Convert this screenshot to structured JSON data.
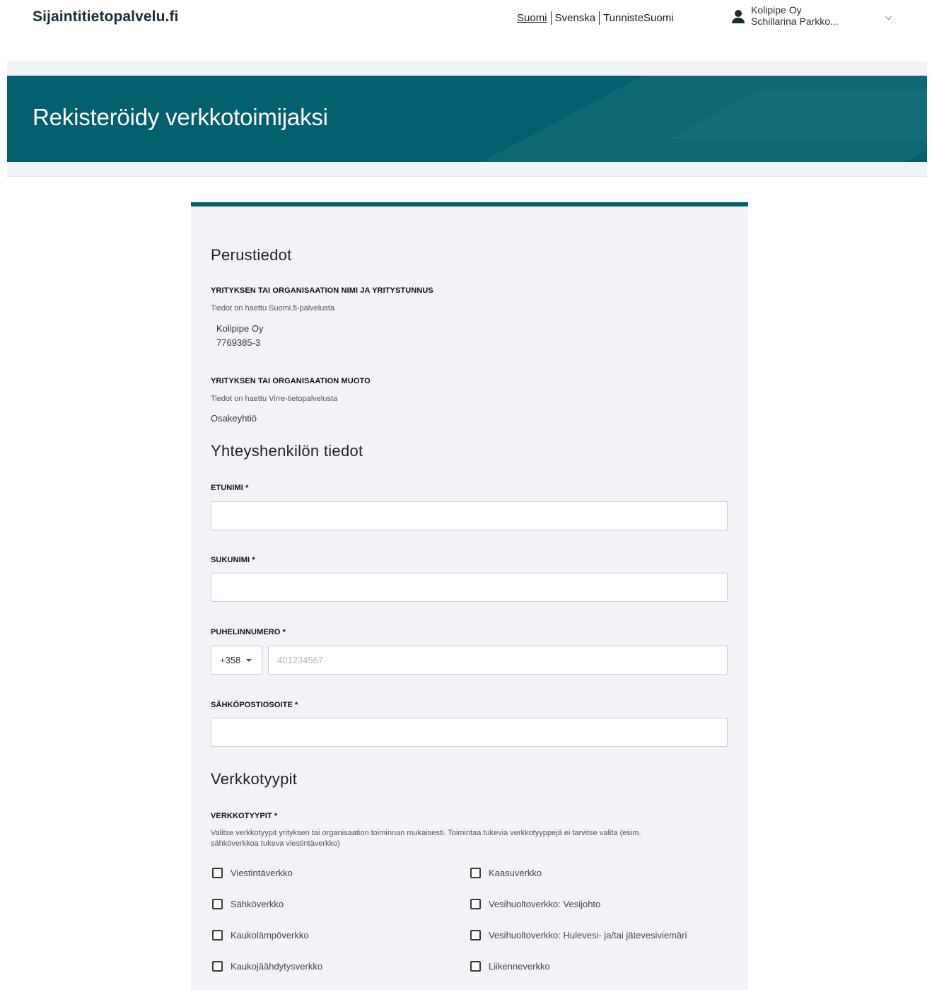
{
  "header": {
    "logo": "Sijaintitietopalvelu.fi",
    "languages": [
      "Suomi",
      "Svenska",
      "TunnisteSuomi"
    ],
    "active_language": "Suomi",
    "user": {
      "org": "Kolipipe Oy",
      "name": "Schillarina Parkko..."
    }
  },
  "page": {
    "title": "Rekisteröidy verkkotoimijaksi"
  },
  "colors": {
    "brand": "#025f6e",
    "card_bg": "#f2f3f6"
  },
  "basic": {
    "title": "Perustiedot",
    "org_label": "YRITYKSEN TAI ORGANISAATION NIMI JA YRITYSTUNNUS",
    "org_hint": "Tiedot on haettu Suomi.fi-palvelusta",
    "org_name": "Kolipipe Oy",
    "org_id": "7769385-3",
    "form_label": "YRITYKSEN TAI ORGANISAATION MUOTO",
    "form_hint": "Tiedot on haettu Virre-tietopalvelusta",
    "form_value": "Osakeyhtiö"
  },
  "contact": {
    "title": "Yhteyshenkilön tiedot",
    "first_name_label": "ETUNIMI *",
    "first_name_value": "",
    "last_name_label": "SUKUNIMI *",
    "last_name_value": "",
    "phone_label": "PUHELINNUMERO *",
    "country_code": "+358",
    "phone_placeholder": "401234567",
    "email_label": "SÄHKÖPOSTIOSOITE *",
    "email_value": ""
  },
  "networks": {
    "title": "Verkkotyypit",
    "label": "VERKKOTYYPIT *",
    "hint_line1": "Valitse verkkotyypit yrityksen tai organisaation toiminnan mukaisesti. Toimintaa tukevia verkkotyyppejä ei tarvitse valita (esim.",
    "hint_line2": "sähköverkkoa tukeva viestintäverkko)",
    "options": [
      {
        "label": "Viestintäverkko",
        "checked": false
      },
      {
        "label": "Kaasuverkko",
        "checked": false
      },
      {
        "label": "Sähköverkko",
        "checked": false
      },
      {
        "label": "Vesihuoltoverkko: Vesijohto",
        "checked": false
      },
      {
        "label": "Kaukolämpöverkko",
        "checked": false
      },
      {
        "label": "Vesihuoltoverkko: Hulevesi- ja/tai jätevesiviemäri",
        "checked": false
      },
      {
        "label": "Kaukojäähdytysverkko",
        "checked": false
      },
      {
        "label": "Liikenneverkko",
        "checked": false
      }
    ]
  }
}
